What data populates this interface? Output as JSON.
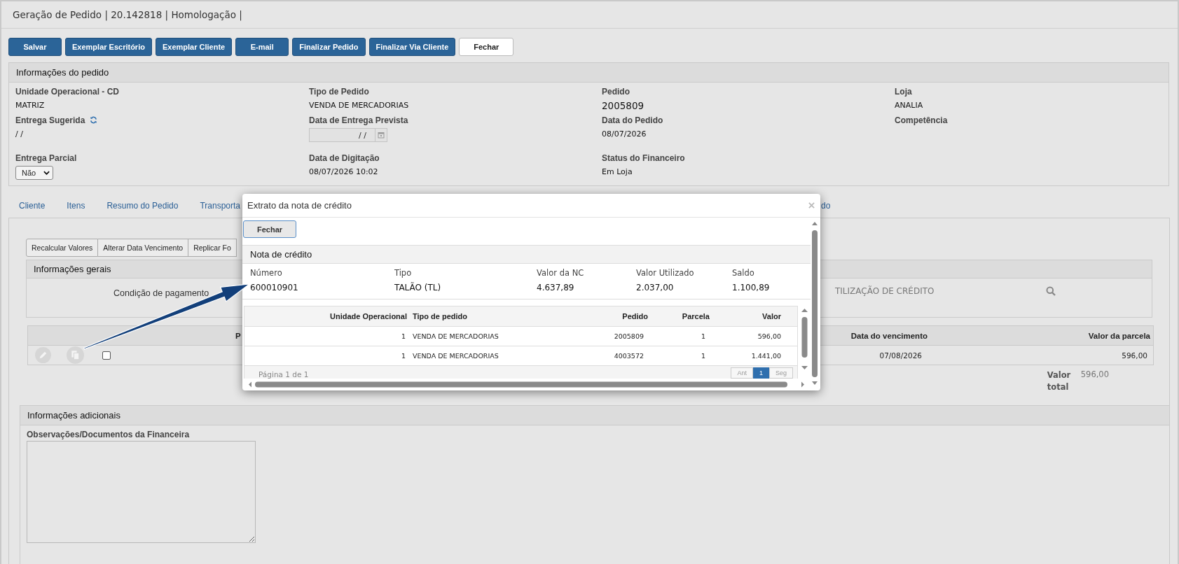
{
  "header": {
    "title": "Geração de Pedido | 20.142818 | Homologação |"
  },
  "toolbar": [
    {
      "label": "Salvar",
      "kind": "primary"
    },
    {
      "label": "Exemplar Escritório",
      "kind": "primary"
    },
    {
      "label": "Exemplar Cliente",
      "kind": "primary"
    },
    {
      "label": "E-mail",
      "kind": "primary"
    },
    {
      "label": "Finalizar Pedido",
      "kind": "primary"
    },
    {
      "label": "Finalizar Via Cliente",
      "kind": "primary"
    },
    {
      "label": "Fechar",
      "kind": "default"
    }
  ],
  "order_info": {
    "title": "Informações do pedido",
    "rows": [
      [
        {
          "label": "Unidade Operacional - CD",
          "kind": "text",
          "value": "MATRIZ"
        },
        {
          "label": "Tipo de Pedido",
          "kind": "text",
          "value": "VENDA DE MERCADORIAS"
        },
        {
          "label": "Pedido",
          "kind": "big",
          "value": "2005809"
        },
        {
          "label": "Loja",
          "kind": "text",
          "value": "ANALIA"
        }
      ],
      [
        {
          "label": "Entrega Sugerida",
          "refresh_button": true,
          "kind": "text",
          "value": "/ /"
        },
        {
          "label": "Data de Entrega Prevista",
          "kind": "date",
          "value": "/ /"
        },
        {
          "label": "Data do Pedido",
          "kind": "text",
          "value": "08/07/2026"
        },
        {
          "label": "Competência",
          "kind": "empty"
        }
      ],
      [
        {
          "label": "Entrega Parcial",
          "kind": "select",
          "value": "Não"
        },
        {
          "label": "Data de Digitação",
          "kind": "text",
          "value": "08/07/2026 10:02"
        },
        {
          "label": "Status do Financeiro",
          "kind": "text",
          "value": "Em Loja"
        }
      ]
    ]
  },
  "tabs": [
    {
      "label": "Cliente"
    },
    {
      "label": "Itens"
    },
    {
      "label": "Resumo do Pedido"
    },
    {
      "label": "Transporta"
    },
    {
      "label": "do"
    }
  ],
  "payment": {
    "actions": [
      "Recalcular Valores",
      "Alterar Data Vencimento",
      "Replicar Fo"
    ],
    "general": {
      "title": "Informações gerais",
      "condition_label": "Condição de pagamento",
      "condition_value": "TILIZAÇÃO DE CRÉDITO"
    },
    "installments": {
      "columns": [
        "P",
        "Data do vencimento",
        "Valor da parcela"
      ],
      "rows": [
        {
          "checked": false,
          "due": "07/08/2026",
          "amount": "596,00"
        }
      ]
    },
    "total_label": "Valor total",
    "total": "596,00"
  },
  "additional": {
    "title": "Informações adicionais",
    "notes_label": "Observações/Documentos da Financeira"
  },
  "modal": {
    "title": "Extrato da nota de crédito",
    "close_button": "Fechar",
    "section_title": "Nota de crédito",
    "summary": [
      {
        "label": "Número",
        "value": "600010901"
      },
      {
        "label": "Tipo",
        "value": "TALÃO (TL)"
      },
      {
        "label": "Valor da NC",
        "value": "4.637,89"
      },
      {
        "label": "Valor Utilizado",
        "value": "2.037,00"
      },
      {
        "label": "Saldo",
        "value": "1.100,89"
      }
    ],
    "table": {
      "columns": [
        "Unidade Operacional",
        "Tipo de pedido",
        "Pedido",
        "Parcela",
        "Valor"
      ],
      "rows": [
        [
          "1",
          "VENDA DE MERCADORIAS",
          "2005809",
          "1",
          "596,00"
        ],
        [
          "1",
          "VENDA DE MERCADORIAS",
          "4003572",
          "1",
          "1.441,00"
        ]
      ]
    },
    "pager": {
      "text": "Página 1 de 1",
      "buttons": [
        {
          "label": "Ant",
          "selected": false
        },
        {
          "label": "1",
          "selected": true
        },
        {
          "label": "Seg",
          "selected": false
        }
      ]
    }
  }
}
